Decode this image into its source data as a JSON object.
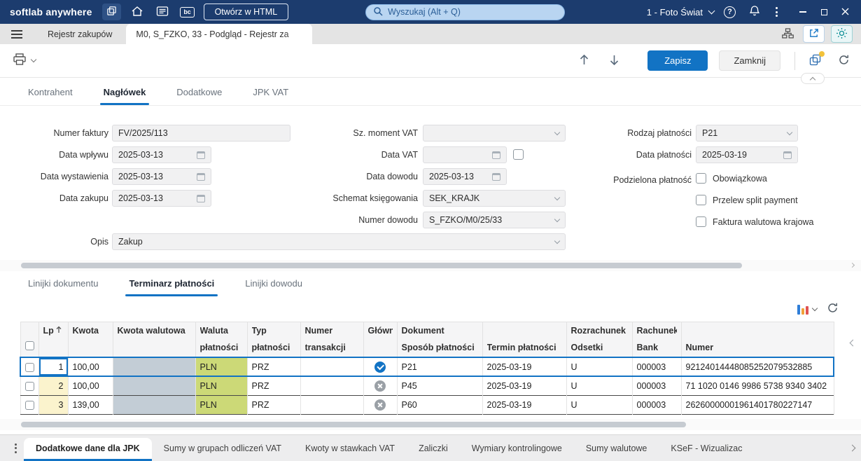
{
  "colors": {
    "titlebar_bg": "#1c3c6e",
    "accent_blue": "#1273c4",
    "search_bg": "#b9d5f1",
    "selected_row_border": "#1273c4",
    "lp_cell_bg": "#fbf3cd",
    "currency_empty_cell_bg": "#c3cdd6",
    "currency_pln_cell_bg": "#ccd977",
    "teal_accent": "#0e8f96",
    "notification_dot": "#f2c23a"
  },
  "titlebar": {
    "app_name": "softlab anywhere",
    "bc_badge": "bc",
    "open_html_button": "Otwórz w HTML",
    "search_placeholder": "Wyszukaj (Alt + Q)",
    "company_selector": "1 - Foto Świat"
  },
  "window_tabs": {
    "register_tab": "Rejestr zakupów",
    "preview_tab": "M0, S_FZKO, 33 - Podgląd - Rejestr za"
  },
  "toolbar": {
    "save": "Zapisz",
    "close": "Zamknij"
  },
  "form_tabs": {
    "kontrahent": "Kontrahent",
    "naglowek": "Nagłówek",
    "dodatkowe": "Dodatkowe",
    "jpk_vat": "JPK VAT"
  },
  "form": {
    "numer_faktury": {
      "label": "Numer faktury",
      "value": "FV/2025/113"
    },
    "data_wplywu": {
      "label": "Data wpływu",
      "value": "2025-03-13"
    },
    "data_wystawienia": {
      "label": "Data wystawienia",
      "value": "2025-03-13"
    },
    "data_zakupu": {
      "label": "Data zakupu",
      "value": "2025-03-13"
    },
    "opis": {
      "label": "Opis",
      "value": "Zakup"
    },
    "sz_moment_vat": {
      "label": "Sz. moment VAT",
      "value": ""
    },
    "data_vat": {
      "label": "Data VAT",
      "value": ""
    },
    "data_dowodu": {
      "label": "Data dowodu",
      "value": "2025-03-13"
    },
    "schemat_ksiegowania": {
      "label": "Schemat księgowania",
      "value": "SEK_KRAJK"
    },
    "numer_dowodu": {
      "label": "Numer dowodu",
      "value": "S_FZKO/M0/25/33"
    },
    "rodzaj_platnosci": {
      "label": "Rodzaj płatności",
      "value": "P21"
    },
    "data_platnosci": {
      "label": "Data płatności",
      "value": "2025-03-19"
    },
    "podzielona_platnosc": {
      "label": "Podzielona płatność",
      "obowiazkowa": "Obowiązkowa",
      "przelew_split": "Przelew split payment",
      "faktura_walutowa": "Faktura walutowa krajowa"
    }
  },
  "grid_tabs": {
    "linijki_dokumentu": "Linijki dokumentu",
    "terminarz_platnosci": "Terminarz płatności",
    "linijki_dowodu": "Linijki dowodu"
  },
  "table": {
    "headers": {
      "lp": "Lp",
      "lp_sort_order": "2",
      "kwota": "Kwota",
      "kwota_walutowa": "Kwota walutowa",
      "waluta_line1": "Waluta",
      "waluta_line2": "płatności",
      "typ_line1": "Typ",
      "typ_line2": "płatności",
      "numer_transakcji_line1": "Numer",
      "numer_transakcji_line2": "transakcji",
      "glowny": "Główny",
      "dokument": "Dokument",
      "sposob_platnosci": "Sposób płatności",
      "termin_platnosci": "Termin płatności",
      "rozrachunek": "Rozrachunek",
      "odsetki": "Odsetki",
      "rachunek": "Rachunek",
      "bank": "Bank",
      "numer": "Numer"
    },
    "rows": [
      {
        "lp": "1",
        "kwota": "100,00",
        "kwota_walutowa": "",
        "waluta_platnosci": "PLN",
        "typ_platnosci": "PRZ",
        "numer_transakcji": "",
        "glowny": "tak",
        "sposob_platnosci": "P21",
        "termin_platnosci": "2025-03-19",
        "odsetki": "U",
        "bank": "000003",
        "numer_rachunku": "92124014448085252079532885",
        "selected": true
      },
      {
        "lp": "2",
        "kwota": "100,00",
        "kwota_walutowa": "",
        "waluta_platnosci": "PLN",
        "typ_platnosci": "PRZ",
        "numer_transakcji": "",
        "glowny": "nie",
        "sposob_platnosci": "P45",
        "termin_platnosci": "2025-03-19",
        "odsetki": "U",
        "bank": "000003",
        "numer_rachunku": "71 1020 0146 9986 5738 9340 3402",
        "selected": false
      },
      {
        "lp": "3",
        "kwota": "139,00",
        "kwota_walutowa": "",
        "waluta_platnosci": "PLN",
        "typ_platnosci": "PRZ",
        "numer_transakcji": "",
        "glowny": "nie",
        "sposob_platnosci": "P60",
        "termin_platnosci": "2025-03-19",
        "odsetki": "U",
        "bank": "000003",
        "numer_rachunku": "26260000001961401780227147",
        "selected": false
      }
    ]
  },
  "bottom_tabs": {
    "dodatkowe_jpk": "Dodatkowe dane dla JPK",
    "sumy_grupy_vat": "Sumy w grupach odliczeń VAT",
    "kwoty_stawki_vat": "Kwoty w stawkach VAT",
    "zaliczki": "Zaliczki",
    "wymiary": "Wymiary kontrolingowe",
    "sumy_walutowe": "Sumy walutowe",
    "ksef": "KSeF - Wizualizac"
  }
}
